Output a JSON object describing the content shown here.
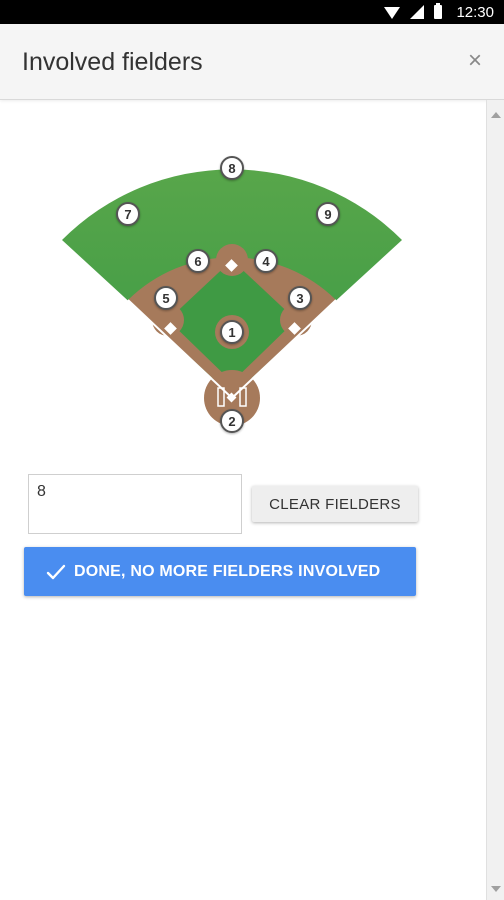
{
  "status_bar": {
    "time": "12:30",
    "icons": [
      "wifi-icon",
      "signal-icon",
      "battery-icon"
    ]
  },
  "dialog": {
    "title": "Involved fielders",
    "close_icon": "close-icon",
    "close_glyph": "×"
  },
  "field": {
    "positions": [
      {
        "number": "1",
        "name": "pitcher"
      },
      {
        "number": "2",
        "name": "catcher"
      },
      {
        "number": "3",
        "name": "first-base"
      },
      {
        "number": "4",
        "name": "second-base"
      },
      {
        "number": "5",
        "name": "third-base"
      },
      {
        "number": "6",
        "name": "shortstop"
      },
      {
        "number": "7",
        "name": "left-field"
      },
      {
        "number": "8",
        "name": "center-field"
      },
      {
        "number": "9",
        "name": "right-field"
      }
    ],
    "colors": {
      "grass": "#4caf50",
      "dirt": "#a67a5b",
      "lines": "#ffffff"
    }
  },
  "input": {
    "value": "8"
  },
  "buttons": {
    "clear_label": "CLEAR FIELDERS",
    "done_label": "DONE, NO MORE FIELDERS INVOLVED",
    "done_icon": "check-icon",
    "done_color": "#4a8df0"
  }
}
